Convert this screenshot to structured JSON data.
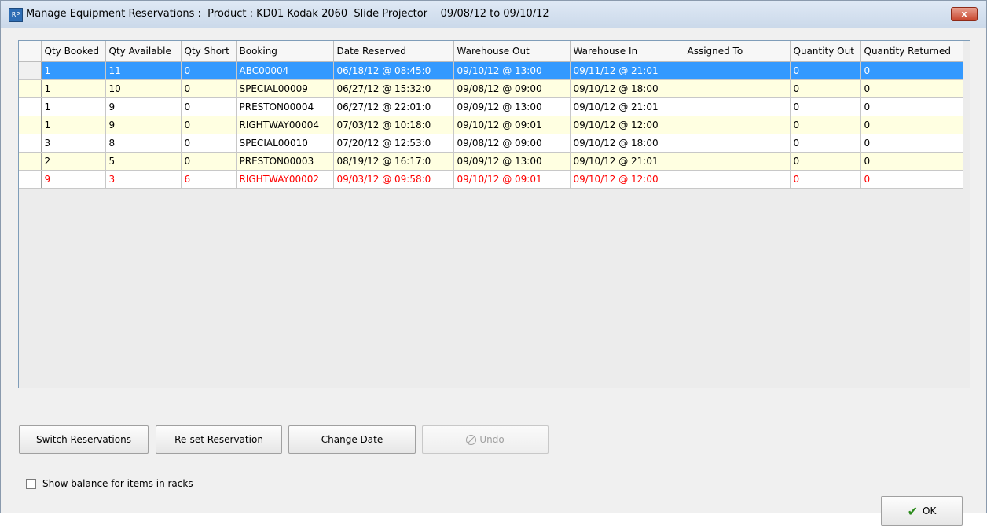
{
  "window": {
    "title": "Manage Equipment Reservations :  Product : KD01 Kodak 2060  Slide Projector    09/08/12 to 09/10/12",
    "app_icon_text": "RP",
    "close_label": "x"
  },
  "grid": {
    "columns": [
      "Qty Booked",
      "Qty Available",
      "Qty Short",
      "Booking",
      "Date Reserved",
      "Warehouse Out",
      "Warehouse In",
      "Assigned To",
      "Quantity Out",
      "Quantity Returned"
    ],
    "rows": [
      {
        "cells": [
          "1",
          "11",
          "0",
          "ABC00004",
          "06/18/12 @ 08:45:0",
          "09/10/12 @ 13:00",
          "09/11/12 @ 21:01",
          "",
          "0",
          "0"
        ],
        "state": "selected"
      },
      {
        "cells": [
          "1",
          "10",
          "0",
          "SPECIAL00009",
          "06/27/12 @ 15:32:0",
          "09/08/12 @ 09:00",
          "09/10/12 @ 18:00",
          "",
          "0",
          "0"
        ],
        "state": "even"
      },
      {
        "cells": [
          "1",
          "9",
          "0",
          "PRESTON00004",
          "06/27/12 @ 22:01:0",
          "09/09/12 @ 13:00",
          "09/10/12 @ 21:01",
          "",
          "0",
          "0"
        ],
        "state": "odd"
      },
      {
        "cells": [
          "1",
          "9",
          "0",
          "RIGHTWAY00004",
          "07/03/12 @ 10:18:0",
          "09/10/12 @ 09:01",
          "09/10/12 @ 12:00",
          "",
          "0",
          "0"
        ],
        "state": "even"
      },
      {
        "cells": [
          "3",
          "8",
          "0",
          "SPECIAL00010",
          "07/20/12 @ 12:53:0",
          "09/08/12 @ 09:00",
          "09/10/12 @ 18:00",
          "",
          "0",
          "0"
        ],
        "state": "odd"
      },
      {
        "cells": [
          "2",
          "5",
          "0",
          "PRESTON00003",
          "08/19/12 @ 16:17:0",
          "09/09/12 @ 13:00",
          "09/10/12 @ 21:01",
          "",
          "0",
          "0"
        ],
        "state": "even"
      },
      {
        "cells": [
          "9",
          "3",
          "6",
          "RIGHTWAY00002",
          "09/03/12 @ 09:58:0",
          "09/10/12 @ 09:01",
          "09/10/12 @ 12:00",
          "",
          "0",
          "0"
        ],
        "state": "short"
      }
    ]
  },
  "buttons": {
    "switch": "Switch Reservations",
    "reset": "Re-set Reservation",
    "change_date": "Change Date",
    "undo": "Undo",
    "ok": "OK"
  },
  "options": {
    "show_balance_label": "Show balance for items in racks",
    "show_balance_checked": false
  },
  "colors": {
    "selection": "#3399ff",
    "alt_row": "#ffffe1",
    "short_text": "#ff0000"
  }
}
